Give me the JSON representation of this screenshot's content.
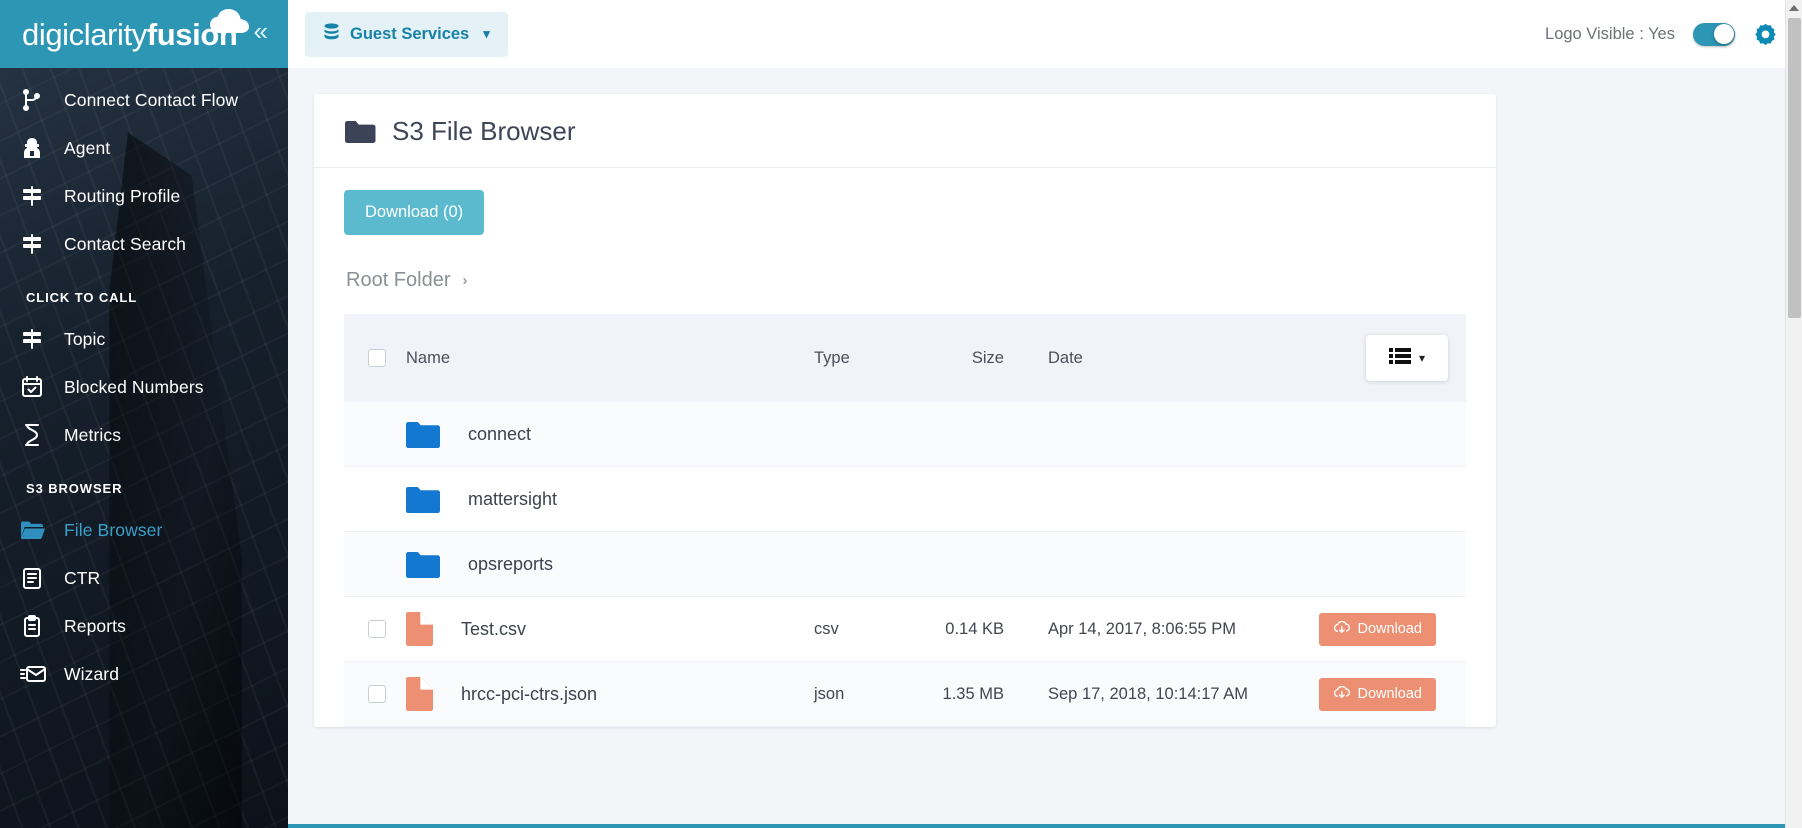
{
  "brand": {
    "name_thin": "digiclarity",
    "name_bold": "fusion",
    "collapse_icon": "chevron-double-left-icon",
    "cloud_icon": "cloud-icon"
  },
  "sidebar": {
    "items": [
      {
        "label": "Connect Contact Flow",
        "icon": "sitemap-icon",
        "active": false
      },
      {
        "label": "Agent",
        "icon": "agent-icon",
        "active": false
      },
      {
        "label": "Routing Profile",
        "icon": "signpost-icon",
        "active": false
      },
      {
        "label": "Contact Search",
        "icon": "signpost-icon",
        "active": false
      }
    ],
    "section_click_to_call": "CLICK TO CALL",
    "click_to_call_items": [
      {
        "label": "Topic",
        "icon": "signpost-icon",
        "active": false
      },
      {
        "label": "Blocked Numbers",
        "icon": "calendar-check-icon",
        "active": false
      },
      {
        "label": "Metrics",
        "icon": "hourglass-icon",
        "active": false
      }
    ],
    "section_s3_browser": "S3 BROWSER",
    "s3_items": [
      {
        "label": "File Browser",
        "icon": "open-folder-icon",
        "active": true
      },
      {
        "label": "CTR",
        "icon": "clipboard-list-icon",
        "active": false
      },
      {
        "label": "Reports",
        "icon": "clipboard-icon",
        "active": false
      },
      {
        "label": "Wizard",
        "icon": "mail-send-icon",
        "active": false
      }
    ]
  },
  "topbar": {
    "service_selector": {
      "label": "Guest Services",
      "icon": "database-icon",
      "caret": "chevron-down-icon"
    },
    "logo_visible_label": "Logo Visible : Yes",
    "toggle_state": "on",
    "settings_icon": "gear-icon"
  },
  "page": {
    "title": "S3 File Browser",
    "title_icon": "folder-icon",
    "download_button": "Download (0)",
    "breadcrumb": {
      "root": "Root Folder",
      "separator": "›"
    }
  },
  "table": {
    "columns": {
      "name": "Name",
      "type": "Type",
      "size": "Size",
      "date": "Date"
    },
    "view_mode_icon": "list-view-icon",
    "view_mode_caret": "chevron-down-icon",
    "rows": [
      {
        "kind": "folder",
        "name": "connect",
        "type": "",
        "size": "",
        "date": "",
        "action": ""
      },
      {
        "kind": "folder",
        "name": "mattersight",
        "type": "",
        "size": "",
        "date": "",
        "action": ""
      },
      {
        "kind": "folder",
        "name": "opsreports",
        "type": "",
        "size": "",
        "date": "",
        "action": ""
      },
      {
        "kind": "file",
        "name": "Test.csv",
        "type": "csv",
        "size": "0.14 KB",
        "date": "Apr 14, 2017, 8:06:55 PM",
        "action": "Download"
      },
      {
        "kind": "file",
        "name": "hrcc-pci-ctrs.json",
        "type": "json",
        "size": "1.35 MB",
        "date": "Sep 17, 2018, 10:14:17 AM",
        "action": "Download"
      }
    ]
  },
  "colors": {
    "brand_teal": "#2d96b5",
    "accent_button": "#5cbacf",
    "download_pill": "#ec8f72",
    "folder_blue": "#1379d0",
    "active_link": "#3aa0c9"
  }
}
